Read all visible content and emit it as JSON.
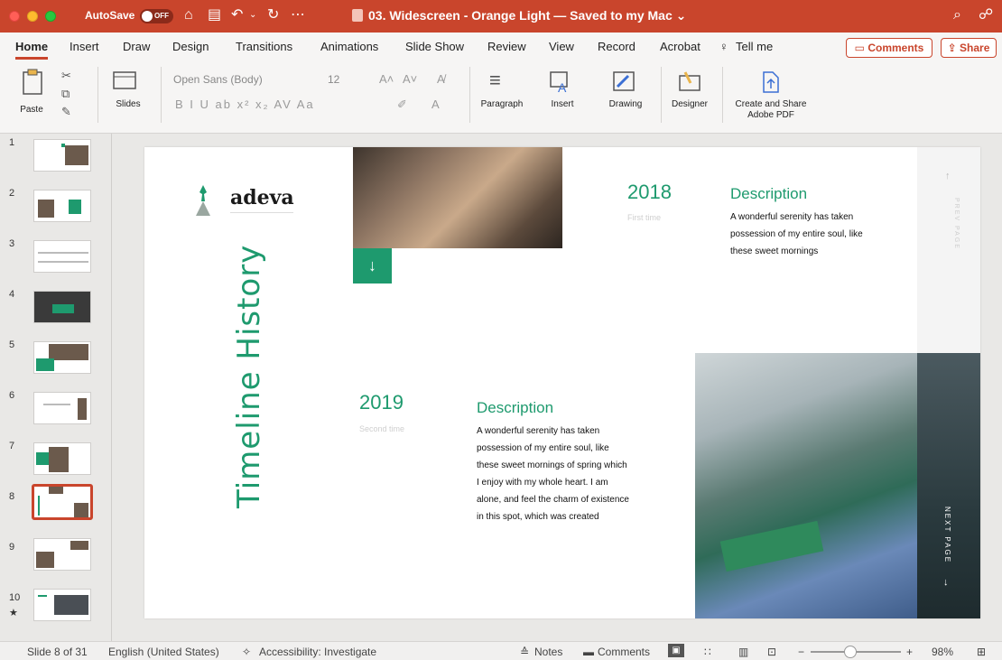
{
  "titlebar": {
    "autosave_label": "AutoSave",
    "autosave_state": "OFF",
    "document_title": "03. Widescreen - Orange Light — Saved to my Mac",
    "title_chevron": "⌄"
  },
  "tabs": [
    "Home",
    "Insert",
    "Draw",
    "Design",
    "Transitions",
    "Animations",
    "Slide Show",
    "Review",
    "View",
    "Record",
    "Acrobat",
    "Tell me"
  ],
  "header_buttons": {
    "comments": "Comments",
    "share": "Share"
  },
  "ribbon": {
    "paste": "Paste",
    "slides": "Slides",
    "font_name": "Open Sans (Body)",
    "font_size": "12",
    "paragraph": "Paragraph",
    "insert": "Insert",
    "drawing": "Drawing",
    "designer": "Designer",
    "create_share": "Create and Share",
    "adobe_pdf": "Adobe PDF"
  },
  "thumbnails": [
    "1",
    "2",
    "3",
    "4",
    "5",
    "6",
    "7",
    "8",
    "9",
    "10"
  ],
  "slide": {
    "logo": "adeva",
    "title": "Timeline History",
    "arrow_down": "↓",
    "entry1": {
      "year": "2018",
      "subtitle": "First time",
      "heading": "Description",
      "body": [
        "A wonderful serenity has taken",
        "possession of my entire soul, like",
        "these sweet mornings"
      ]
    },
    "entry2": {
      "year": "2019",
      "subtitle": "Second time",
      "heading": "Description",
      "body": [
        "A wonderful serenity has taken",
        "possession of my entire soul, like",
        "these sweet mornings of spring which",
        "I enjoy with my whole heart. I am",
        "alone, and feel the charm of existence",
        "in this spot, which was created"
      ]
    },
    "prev_page": "PREV PAGE",
    "next_page": "NEXT PAGE"
  },
  "status": {
    "slide_info": "Slide 8 of 31",
    "language": "English (United States)",
    "accessibility": "Accessibility: Investigate",
    "notes": "Notes",
    "comments": "Comments",
    "zoom": "98%"
  },
  "colors": {
    "accent": "#c9452c",
    "slide_green": "#1e9a6e"
  }
}
